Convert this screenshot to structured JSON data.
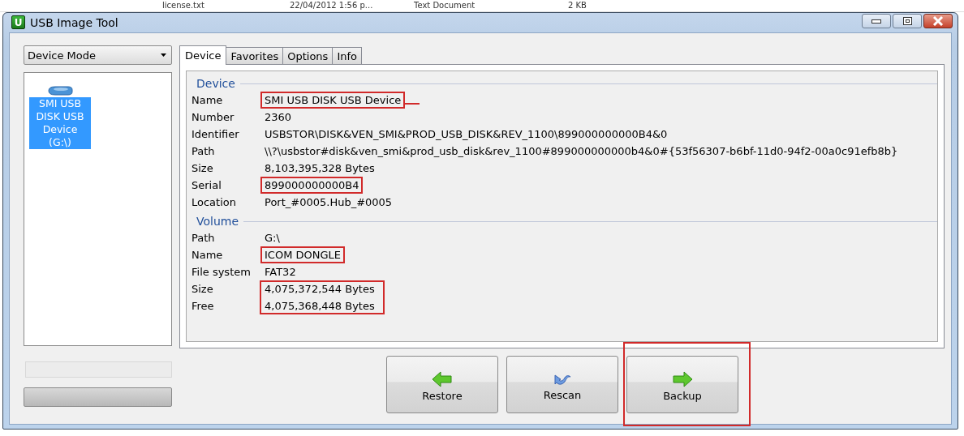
{
  "background": {
    "file_row": [
      "license.txt",
      "22/04/2012 1:56 p...",
      "Text Document",
      "2 KB"
    ]
  },
  "window": {
    "title": "USB Image Tool",
    "icon_letter": "U"
  },
  "mode_dropdown": {
    "value": "Device Mode"
  },
  "devices": [
    {
      "label": "SMI USB DISK USB Device (G:\\)",
      "selected": true
    }
  ],
  "tabs": [
    {
      "label": "Device",
      "selected": true
    },
    {
      "label": "Favorites",
      "selected": false
    },
    {
      "label": "Options",
      "selected": false
    },
    {
      "label": "Info",
      "selected": false
    }
  ],
  "sections": [
    {
      "title": "Device",
      "rows": [
        {
          "label": "Name",
          "value": "SMI USB DISK USB Device",
          "marked": true,
          "dash": true
        },
        {
          "label": "Number",
          "value": "2360",
          "marked": false
        },
        {
          "label": "Identifier",
          "value": "USBSTOR\\DISK&VEN_SMI&PROD_USB_DISK&REV_1100\\899000000000B4&0",
          "marked": false
        },
        {
          "label": "Path",
          "value": "\\\\?\\usbstor#disk&ven_smi&prod_usb_disk&rev_1100#899000000000b4&0#{53f56307-b6bf-11d0-94f2-00a0c91efb8b}",
          "marked": false
        },
        {
          "label": "Size",
          "value": "8,103,395,328 Bytes",
          "marked": false
        },
        {
          "label": "Serial",
          "value": "899000000000B4",
          "marked": true
        },
        {
          "label": "Location",
          "value": "Port_#0005.Hub_#0005",
          "marked": false
        }
      ]
    },
    {
      "title": "Volume",
      "rows": [
        {
          "label": "Path",
          "value": "G:\\",
          "marked": false
        },
        {
          "label": "Name",
          "value": "ICOM DONGLE",
          "marked": true
        },
        {
          "label": "File system",
          "value": "FAT32",
          "marked": false
        },
        {
          "label": "Size",
          "value": "4,075,372,544 Bytes",
          "marked": true
        },
        {
          "label": "Free",
          "value": "4,075,368,448 Bytes",
          "marked": true
        }
      ]
    }
  ],
  "progress": {
    "level": 0
  },
  "buttons": [
    {
      "label": "Restore",
      "kind": "left",
      "marked": false
    },
    {
      "label": "Rescan",
      "kind": "curved",
      "marked": false
    },
    {
      "label": "Backup",
      "kind": "right",
      "marked": true
    }
  ]
}
